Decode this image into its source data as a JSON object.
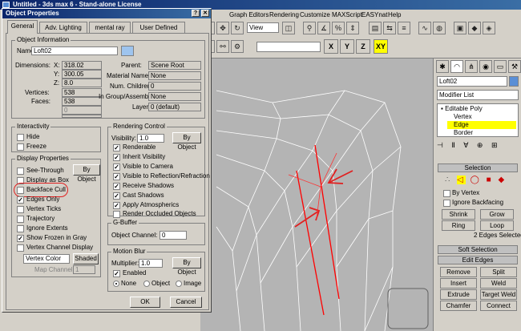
{
  "app": {
    "title": "Untitled - 3ds max 6 - Stand-alone License"
  },
  "menubar": [
    "Graph Editors",
    "Rendering",
    "Customize",
    "MAXScript",
    "EASYnat",
    "Help"
  ],
  "toolbar": {
    "view_combo": "View",
    "selection_combo": "",
    "axes": [
      "X",
      "Y",
      "Z",
      "XY"
    ]
  },
  "dialog": {
    "title": "Object Properties",
    "tabs": [
      "General",
      "Adv. Lighting",
      "mental ray",
      "User Defined"
    ],
    "object_info": {
      "group_label": "Object Information",
      "name_label": "Name:",
      "name_value": "Loft02",
      "dimensions_label": "Dimensions:",
      "x_label": "X:",
      "x_value": "318.02",
      "y_label": "Y:",
      "y_value": "300.05",
      "z_label": "Z:",
      "z_value": "8.0",
      "vertices_label": "Vertices:",
      "vertices_value": "538",
      "faces_label": "Faces:",
      "faces_value": "538",
      "blank1": "0",
      "blank2": "0",
      "parent_label": "Parent:",
      "parent_value": "Scene Root",
      "material_label": "Material Name:",
      "material_value": "None",
      "children_label": "Num. Children:",
      "children_value": "0",
      "group_label2": "In Group/Assembly:",
      "group_value": "None",
      "layer_label": "Layer:",
      "layer_value": "0 (default)"
    },
    "interactivity": {
      "label": "Interactivity",
      "hide": "Hide",
      "freeze": "Freeze"
    },
    "display": {
      "label": "Display Properties",
      "see_through": "See-Through",
      "by_object": "By Object",
      "display_as_box": "Display as Box",
      "backface_cull": "Backface Cull",
      "edges_only": "Edges Only",
      "vertex_ticks": "Vertex Ticks",
      "trajectory": "Trajectory",
      "ignore_extents": "Ignore Extents",
      "show_frozen": "Show Frozen in Gray",
      "vertex_channel": "Vertex Channel Display",
      "vertex_color": "Vertex Color",
      "shaded": "Shaded",
      "map_channel": "Map Channel:",
      "map_channel_value": "1"
    },
    "rendering": {
      "label": "Rendering Control",
      "visibility_label": "Visibility:",
      "visibility_value": "1.0",
      "by_object": "By Object",
      "renderable": "Renderable",
      "inherit_visibility": "Inherit Visibility",
      "visible_camera": "Visible to Camera",
      "visible_reflection": "Visible to Reflection/Refraction",
      "receive_shadows": "Receive Shadows",
      "cast_shadows": "Cast Shadows",
      "apply_atmospherics": "Apply Atmospherics",
      "render_occluded": "Render Occluded Objects"
    },
    "gbuffer": {
      "label": "G-Buffer",
      "channel_label": "Object Channel:",
      "channel_value": "0"
    },
    "motion_blur": {
      "label": "Motion Blur",
      "multiplier_label": "Multiplier:",
      "multiplier_value": "1.0",
      "by_object": "By Object",
      "enabled": "Enabled",
      "none": "None",
      "object": "Object",
      "image": "Image"
    },
    "ok": "OK",
    "cancel": "Cancel"
  },
  "command_panel": {
    "object_name": "Loft02",
    "modifier_list": "Modifier List",
    "stack": [
      "Editable Poly",
      "Vertex",
      "Edge",
      "Border"
    ],
    "selection_title": "Selection",
    "by_vertex": "By Vertex",
    "ignore_backfacing": "Ignore Backfacing",
    "shrink": "Shrink",
    "grow": "Grow",
    "ring": "Ring",
    "loop": "Loop",
    "status": "2 Edges Selected",
    "soft_selection": "Soft Selection",
    "edit_edges": "Edit Edges",
    "remove": "Remove",
    "split": "Split",
    "insert_vertex": "Insert Vertex",
    "weld": "Weld",
    "extrude": "Extrude",
    "target_weld": "Target Weld",
    "chamfer": "Chamfer",
    "connect": "Connect"
  },
  "colors": {
    "title_bar": "#0a246a",
    "selected_edge": "#ff0000",
    "highlight": "#ffff00",
    "annotation": "#e02020"
  }
}
